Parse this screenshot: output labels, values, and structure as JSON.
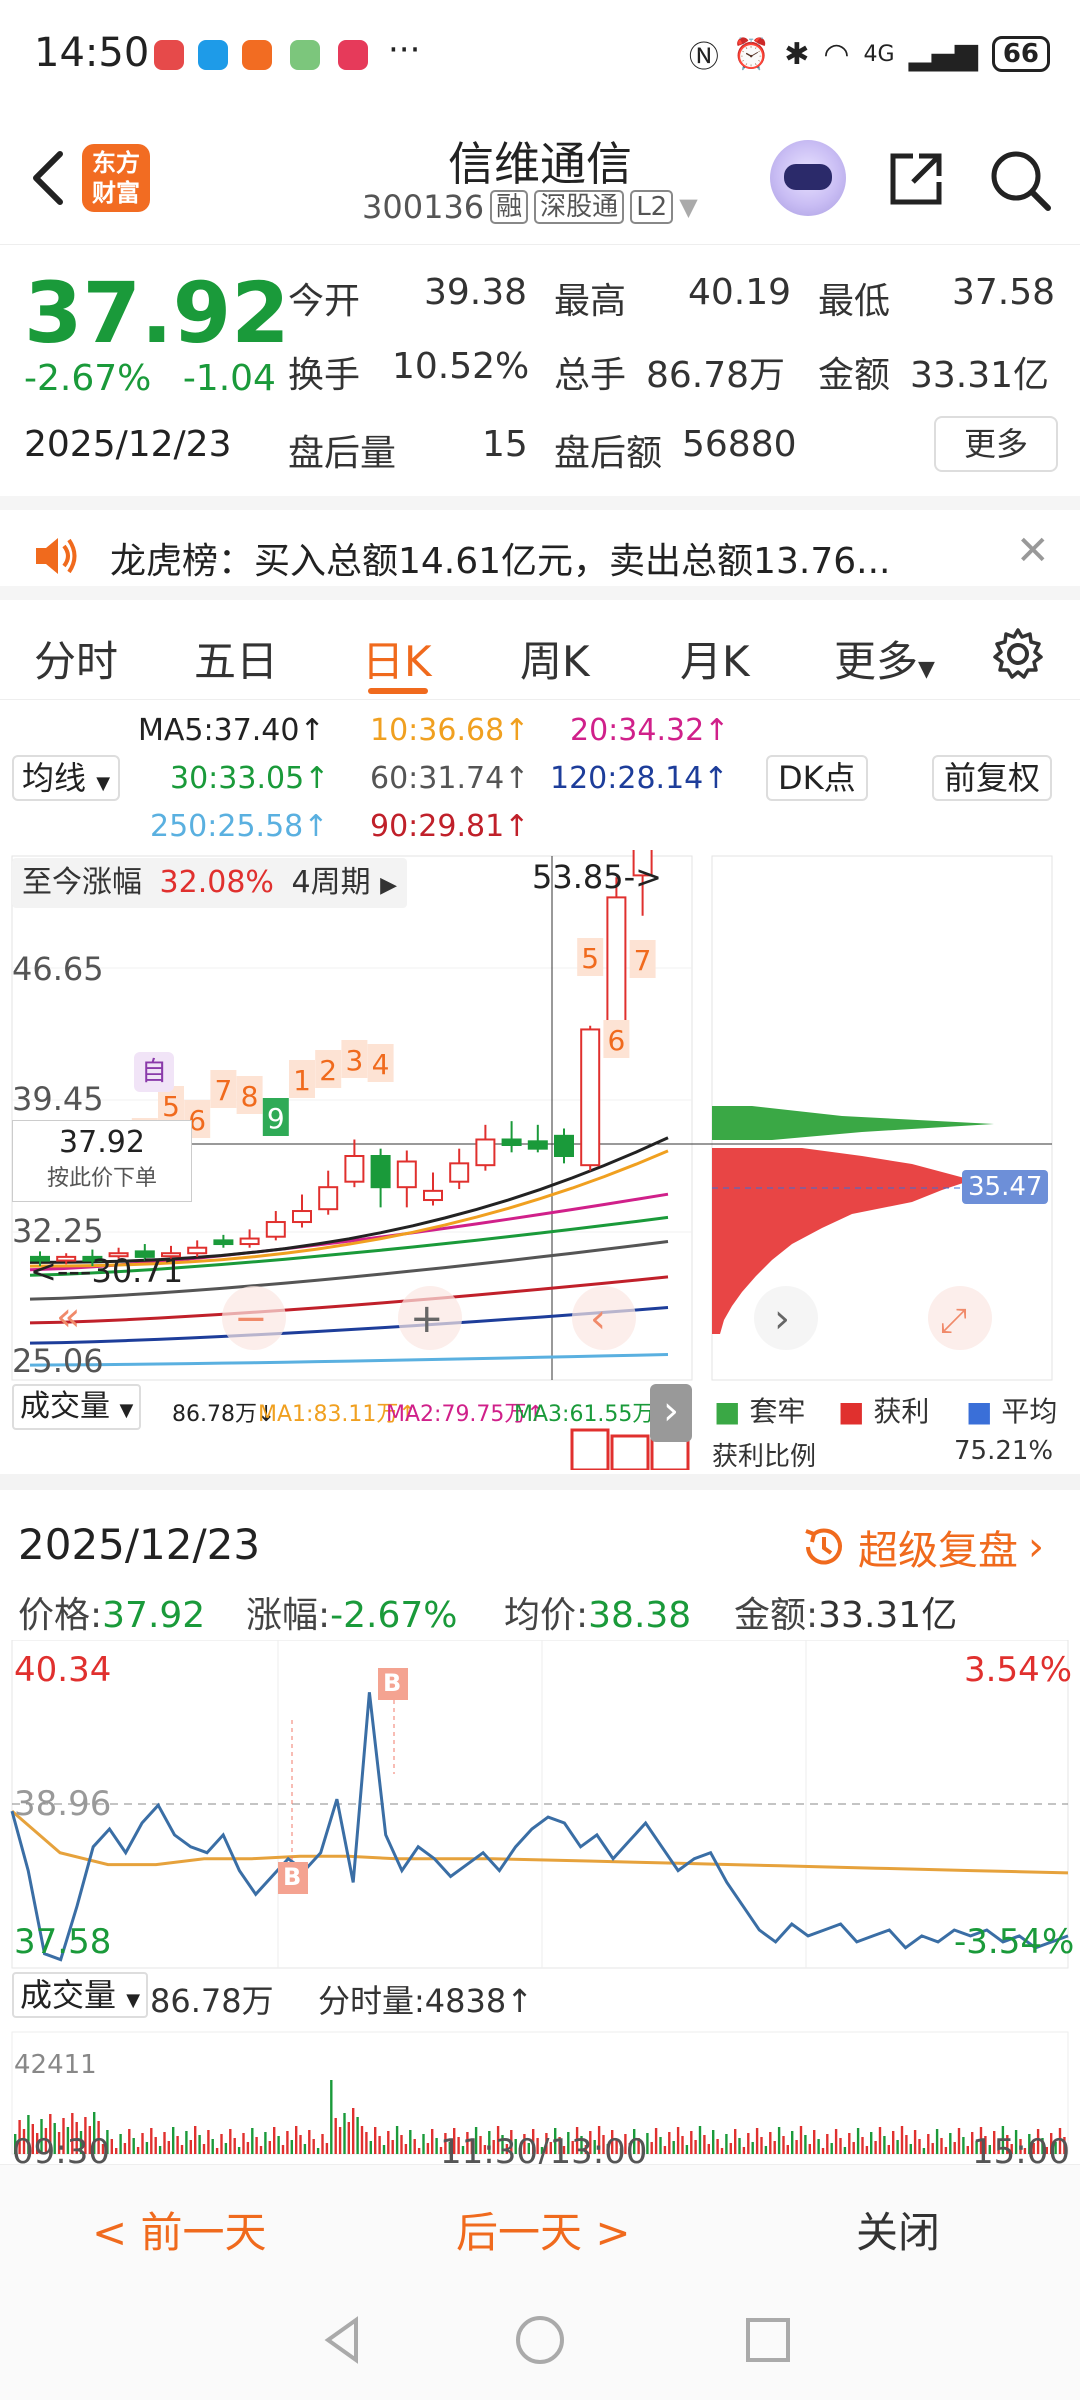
{
  "status": {
    "time": "14:50",
    "net": "4G",
    "battery": "66"
  },
  "header": {
    "logo_line1": "东方",
    "logo_line2": "财富",
    "name": "信维通信",
    "code": "300136",
    "tags": [
      "融",
      "深股通",
      "L2"
    ]
  },
  "quote": {
    "price": "37.92",
    "chg_pct": "-2.67%",
    "chg_abs": "-1.04",
    "date": "2025/12/23",
    "open_label": "今开",
    "open": "39.38",
    "high_label": "最高",
    "high": "40.19",
    "low_label": "最低",
    "low": "37.58",
    "turnover_label": "换手",
    "turnover": "10.52%",
    "volume_label": "总手",
    "volume": "86.78万",
    "amount_label": "金额",
    "amount": "33.31亿",
    "ah_vol_label": "盘后量",
    "ah_vol": "15",
    "ah_amt_label": "盘后额",
    "ah_amt": "56880",
    "more": "更多"
  },
  "notice": {
    "text": "龙虎榜：买入总额14.61亿元，卖出总额13.76..."
  },
  "tabs": [
    "分时",
    "五日",
    "日K",
    "周K",
    "月K",
    "更多"
  ],
  "active_tab": "日K",
  "ma": {
    "ma5": "MA5:37.40↑",
    "ma10": "10:36.68↑",
    "ma20": "20:34.32↑",
    "ma30": "30:33.05↑",
    "ma60": "60:31.74↑",
    "ma120": "120:28.14↑",
    "ma250": "250:25.58↑",
    "ma90": "90:29.81↑",
    "junxian": "均线",
    "dk": "DK点",
    "fuquan": "前复权",
    "colors": {
      "ma5": "#222222",
      "ma10": "#f0a020",
      "ma20": "#d0208a",
      "ma30": "#1a9a3a",
      "ma60": "#555555",
      "ma120": "#1d3d9a",
      "ma250": "#5ab0e0",
      "ma90": "#c0202a"
    }
  },
  "kline": {
    "since_label": "至今涨幅",
    "since_value": "32.08%",
    "since_period": "4周期",
    "high_mark": "53.85->",
    "low_mark": "<---30.71",
    "y_labels": [
      "46.65",
      "39.45",
      "32.25",
      "25.06"
    ],
    "price_tag": "37.92",
    "price_tag_sub": "按此价下单",
    "auto_tag": "自",
    "cost_mark": "35.47",
    "vol_label": "成交量",
    "vol_value": "86.78万↓",
    "vol_ma1": "MA1:83.11万↑",
    "vol_ma2": "MA2:79.75万↑",
    "vol_ma3": "MA3:61.55万↑",
    "chip_legend": [
      "套牢",
      "获利",
      "平均"
    ],
    "chip_ratio_label": "获利比例",
    "chip_ratio": "75.21%",
    "seq_numbers": [
      "4",
      "5",
      "6",
      "7",
      "8",
      "9",
      "1",
      "2",
      "3",
      "4",
      "5",
      "6",
      "7"
    ],
    "candles": [
      {
        "o": 30.9,
        "c": 30.7,
        "h": 31.2,
        "l": 30.4
      },
      {
        "o": 30.7,
        "c": 30.9,
        "h": 31.1,
        "l": 30.5
      },
      {
        "o": 30.9,
        "c": 30.7,
        "h": 31.3,
        "l": 30.4
      },
      {
        "o": 31.0,
        "c": 31.1,
        "h": 31.4,
        "l": 30.8
      },
      {
        "o": 31.2,
        "c": 30.9,
        "h": 31.6,
        "l": 30.7
      },
      {
        "o": 31.0,
        "c": 31.1,
        "h": 31.5,
        "l": 30.8
      },
      {
        "o": 31.1,
        "c": 31.4,
        "h": 31.8,
        "l": 30.9
      },
      {
        "o": 31.8,
        "c": 31.6,
        "h": 32.1,
        "l": 31.4
      },
      {
        "o": 31.6,
        "c": 31.9,
        "h": 32.4,
        "l": 31.4
      },
      {
        "o": 32.0,
        "c": 32.8,
        "h": 33.4,
        "l": 31.8
      },
      {
        "o": 32.8,
        "c": 33.4,
        "h": 34.3,
        "l": 32.5
      },
      {
        "o": 33.5,
        "c": 34.7,
        "h": 35.6,
        "l": 33.2
      },
      {
        "o": 35.0,
        "c": 36.4,
        "h": 37.3,
        "l": 34.7
      },
      {
        "o": 36.4,
        "c": 34.7,
        "h": 36.8,
        "l": 33.6
      },
      {
        "o": 34.7,
        "c": 36.1,
        "h": 36.7,
        "l": 33.6
      },
      {
        "o": 34.0,
        "c": 34.5,
        "h": 35.5,
        "l": 33.7
      },
      {
        "o": 35.0,
        "c": 36.0,
        "h": 36.8,
        "l": 34.6
      },
      {
        "o": 35.9,
        "c": 37.3,
        "h": 38.1,
        "l": 35.6
      },
      {
        "o": 37.3,
        "c": 37.0,
        "h": 38.3,
        "l": 36.6
      },
      {
        "o": 37.2,
        "c": 36.8,
        "h": 38.1,
        "l": 36.6
      },
      {
        "o": 37.5,
        "c": 36.4,
        "h": 37.9,
        "l": 36.0
      },
      {
        "o": 35.9,
        "c": 43.3,
        "h": 43.5,
        "l": 35.6
      },
      {
        "o": 43.4,
        "c": 50.5,
        "h": 51.6,
        "l": 43.1
      },
      {
        "o": 51.7,
        "c": 53.8,
        "h": 55.4,
        "l": 49.5
      }
    ]
  },
  "replay": {
    "date": "2025/12/23",
    "super": "超级复盘",
    "price_label": "价格:",
    "price": "37.92",
    "chg_label": "涨幅:",
    "chg": "-2.67%",
    "avg_label": "均价:",
    "avg": "38.38",
    "amt_label": "金额:",
    "amt": "33.31亿",
    "y_top": "40.34",
    "y_mid": "38.96",
    "y_bot": "37.58",
    "pct_top": "3.54%",
    "pct_bot": "-3.54%",
    "buy_mark": "B",
    "vol_label": "成交量",
    "vol": "86.78万",
    "tick_vol": "分时量:4838↑",
    "vol_axis": "42411",
    "times": [
      "09:30",
      "11:30/13:00",
      "15:00"
    ]
  },
  "bottom": {
    "prev": "< 前一天",
    "next": "后一天 >",
    "close": "关闭"
  }
}
